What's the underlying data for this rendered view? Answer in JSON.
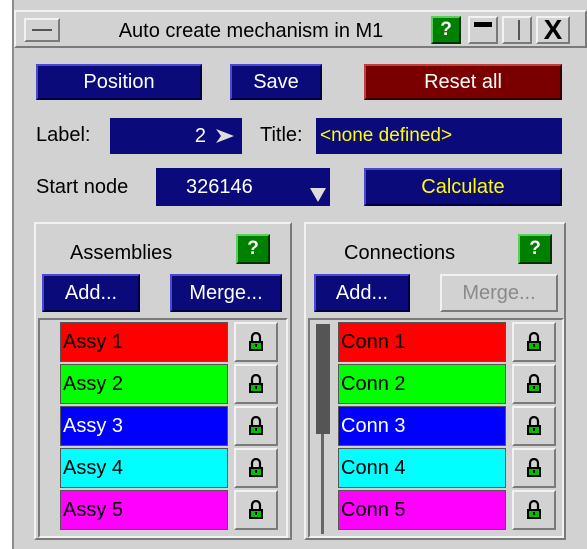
{
  "window": {
    "title": "Auto create mechanism in M1"
  },
  "title_controls": {
    "help": "?",
    "minimize": "minimize-icon",
    "maximize": "maximize-icon",
    "close": "X"
  },
  "toolbar": {
    "position_label": "Position",
    "save_label": "Save",
    "reset_label": "Reset all"
  },
  "label_row": {
    "label_caption": "Label:",
    "label_value": "2",
    "title_caption": "Title:",
    "title_value": "<none defined>"
  },
  "start_row": {
    "start_caption": "Start node",
    "start_value": "326146",
    "calculate_label": "Calculate"
  },
  "assemblies": {
    "heading": "Assemblies",
    "help": "?",
    "add_label": "Add...",
    "merge_label": "Merge...",
    "items": [
      {
        "label": "Assy 1",
        "color": "#ff0000"
      },
      {
        "label": "Assy 2",
        "color": "#00ff00"
      },
      {
        "label": "Assy 3",
        "color": "#0000ff"
      },
      {
        "label": "Assy 4",
        "color": "#00ffff"
      },
      {
        "label": "Assy 5",
        "color": "#ff00ff"
      }
    ]
  },
  "connections": {
    "heading": "Connections",
    "help": "?",
    "add_label": "Add...",
    "merge_label": "Merge...",
    "items": [
      {
        "label": "Conn 1",
        "color": "#ff0000"
      },
      {
        "label": "Conn 2",
        "color": "#00ff00"
      },
      {
        "label": "Conn 3",
        "color": "#0000ff"
      },
      {
        "label": "Conn 4",
        "color": "#00ffff"
      },
      {
        "label": "Conn 5",
        "color": "#ff00ff"
      }
    ]
  },
  "colors": {
    "button_blue": "#0a0a7a",
    "button_red": "#7a0000",
    "help_green": "#008000",
    "calculate_text": "#ffff00",
    "title_text": "#ffff00"
  }
}
